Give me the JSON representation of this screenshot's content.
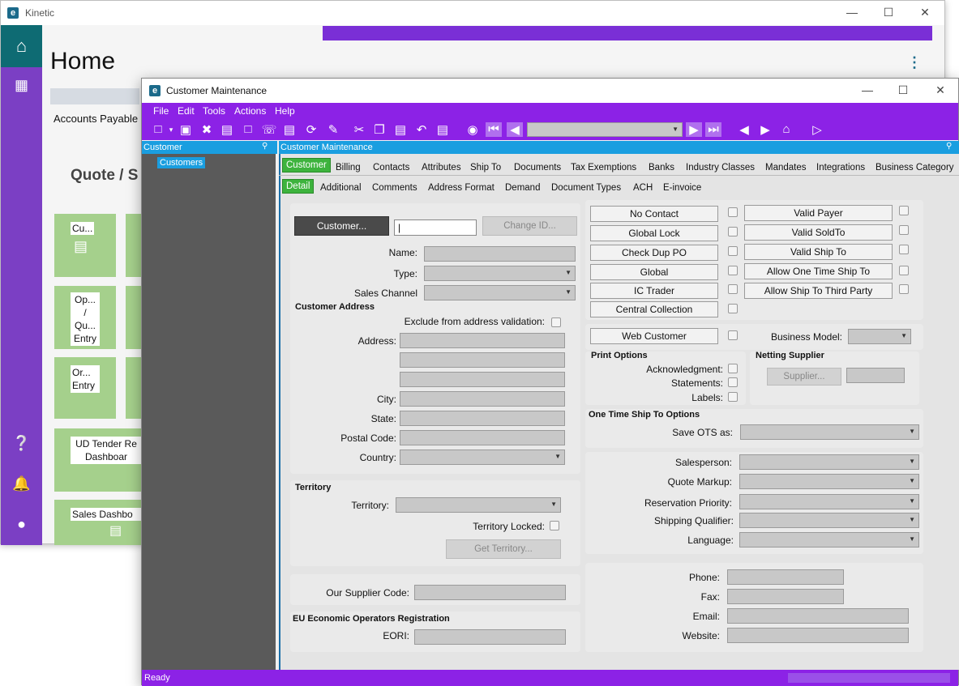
{
  "kinetic": {
    "app_name": "Kinetic",
    "page_title": "Home",
    "section_label": "Accounts Payable",
    "group_heading": "Quote / S",
    "tiles": [
      {
        "label": "Cu..."
      },
      {
        "label": "Op... / Qu... Entry"
      },
      {
        "label": "Or... Entry"
      },
      {
        "label": "UD Tender Re Dashboar"
      },
      {
        "label": "Sales Dashbo"
      }
    ],
    "rail_icons": [
      "home-icon",
      "apps-grid-icon",
      "help-icon",
      "bell-icon",
      "user-icon"
    ]
  },
  "cm": {
    "title": "Customer Maintenance",
    "menu": [
      "File",
      "Edit",
      "Tools",
      "Actions",
      "Help"
    ],
    "tree_header": "Customer",
    "tree_item": "Customers",
    "main_header": "Customer Maintenance",
    "tabs_row1": [
      "Customer",
      "Billing",
      "Contacts",
      "Attributes",
      "Ship To",
      "Documents",
      "Tax Exemptions",
      "Banks",
      "Industry Classes",
      "Mandates",
      "Integrations",
      "Business Category"
    ],
    "tabs_row2": [
      "Detail",
      "Additional",
      "Comments",
      "Address Format",
      "Demand",
      "Document Types",
      "ACH",
      "E-invoice"
    ],
    "customer_button": "Customer...",
    "customer_id_value": "|",
    "change_id_button": "Change ID...",
    "name_label": "Name:",
    "type_label": "Type:",
    "sales_channel_label": "Sales Channel",
    "customer_address_title": "Customer Address",
    "exclude_label": "Exclude from address validation:",
    "address_label": "Address:",
    "city_label": "City:",
    "state_label": "State:",
    "postal_label": "Postal Code:",
    "country_label": "Country:",
    "territory_title": "Territory",
    "territory_label": "Territory:",
    "territory_locked_label": "Territory Locked:",
    "get_territory_button": "Get Territory...",
    "supplier_code_label": "Our Supplier Code:",
    "eu_title": "EU Economic Operators Registration",
    "eori_label": "EORI:",
    "flags_left": [
      "No Contact",
      "Global Lock",
      "Check Dup PO",
      "Global",
      "IC Trader",
      "Central Collection"
    ],
    "flags_right": [
      "Valid Payer",
      "Valid SoldTo",
      "Valid Ship To",
      "Allow One Time Ship To",
      "Allow Ship To Third Party"
    ],
    "web_customer_button": "Web Customer",
    "business_model_label": "Business Model:",
    "print_options_title": "Print Options",
    "acknowledgment_label": "Acknowledgment:",
    "statements_label": "Statements:",
    "labels_label": "Labels:",
    "netting_title": "Netting Supplier",
    "supplier_button": "Supplier...",
    "ots_title": "One Time Ship To Options",
    "save_ots_label": "Save OTS as:",
    "salesperson_label": "Salesperson:",
    "quote_markup_label": "Quote Markup:",
    "reservation_priority_label": "Reservation Priority:",
    "shipping_qualifier_label": "Shipping Qualifier:",
    "language_label": "Language:",
    "phone_label": "Phone:",
    "fax_label": "Fax:",
    "email_label": "Email:",
    "website_label": "Website:",
    "status": "Ready"
  },
  "colors": {
    "accent_purple": "#8c22e6",
    "rail_purple": "#7b3fc4",
    "header_blue": "#1a9ee0",
    "tab_green": "#3db33d",
    "tile_green": "#a5d08c"
  }
}
